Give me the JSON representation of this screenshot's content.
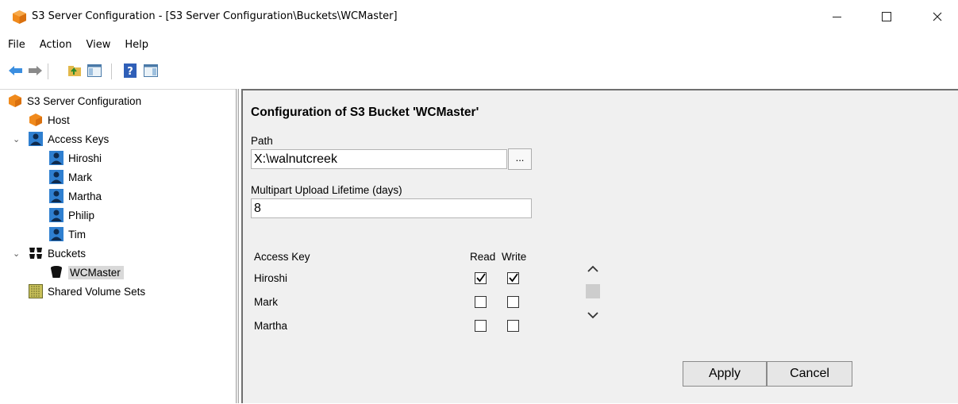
{
  "window": {
    "title": "S3 Server Configuration - [S3 Server Configuration\\Buckets\\WCMaster]"
  },
  "menu": [
    "File",
    "Action",
    "View",
    "Help"
  ],
  "toolbar": {
    "icons": [
      "back-arrow-icon",
      "forward-arrow-icon",
      "up-folder-icon",
      "show-hide-tree-icon",
      "help-icon",
      "action-pane-icon"
    ]
  },
  "tree": {
    "root": "S3 Server Configuration",
    "host": "Host",
    "access_keys": "Access Keys",
    "keys": [
      "Hiroshi",
      "Mark",
      "Martha",
      "Philip",
      "Tim"
    ],
    "buckets": "Buckets",
    "bucket_items": [
      "WCMaster"
    ],
    "shared_volume_sets": "Shared Volume Sets"
  },
  "config": {
    "heading": "Configuration of S3 Bucket 'WCMaster'",
    "path_label": "Path",
    "path_value": "X:\\walnutcreek",
    "browse_label": "...",
    "lifetime_label": "Multipart Upload Lifetime (days)",
    "lifetime_value": "8",
    "table": {
      "col_key": "Access Key",
      "col_read": "Read",
      "col_write": "Write",
      "rows": [
        {
          "key": "Hiroshi",
          "read": true,
          "write": true
        },
        {
          "key": "Mark",
          "read": false,
          "write": false
        },
        {
          "key": "Martha",
          "read": false,
          "write": false
        }
      ]
    },
    "apply": "Apply",
    "cancel": "Cancel"
  },
  "colors": {
    "app_icon": "#f08a1c",
    "selection": "#d9d9d9",
    "pane_bg": "#f0f0f0",
    "user_icon": "#2f7fd0"
  }
}
